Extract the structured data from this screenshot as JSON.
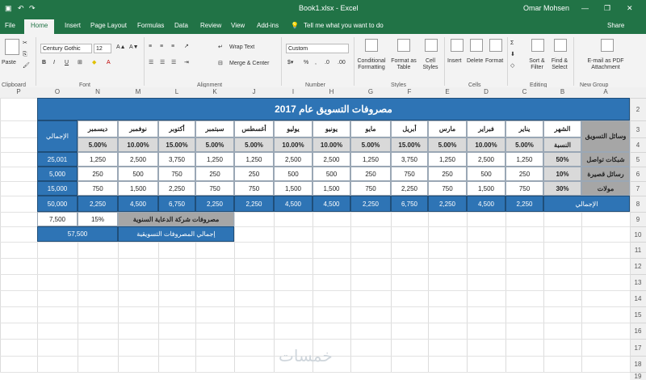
{
  "titlebar": {
    "file_name": "Book1.xlsx - Excel",
    "user": "Omar Mohsen"
  },
  "tabs": [
    "File",
    "Home",
    "Insert",
    "Page Layout",
    "Formulas",
    "Data",
    "Review",
    "View",
    "Add-ins"
  ],
  "tell_me": "Tell me what you want to do",
  "share": "Share",
  "ribbon": {
    "paste": "Paste",
    "font_name": "Century Gothic",
    "font_size": "12",
    "wrap_text": "Wrap Text",
    "merge_center": "Merge & Center",
    "number_format": "Custom",
    "conditional": "Conditional Formatting",
    "format_table": "Format as Table",
    "cell_styles": "Cell Styles",
    "insert": "Insert",
    "delete": "Delete",
    "format": "Format",
    "sort_filter": "Sort & Filter",
    "find_select": "Find & Select",
    "email_pdf": "E-mail as PDF Attachment",
    "groups": [
      "Clipboard",
      "Font",
      "Alignment",
      "Number",
      "Styles",
      "Cells",
      "Editing",
      "New Group"
    ]
  },
  "columns": [
    "P",
    "O",
    "N",
    "M",
    "L",
    "K",
    "J",
    "I",
    "H",
    "G",
    "F",
    "E",
    "D",
    "C",
    "B",
    "A"
  ],
  "rows": [
    "2",
    "3",
    "4",
    "5",
    "6",
    "7",
    "8",
    "9",
    "10",
    "11",
    "12",
    "13",
    "14",
    "15",
    "16",
    "17",
    "18",
    "19"
  ],
  "sheet": {
    "title": "مصروفات التسويق عام 2017",
    "corner_month": "الشهر",
    "corner_channel": "وسائل التسويق",
    "corner_pct": "النسبة",
    "total_label": "الإجمالي",
    "months": [
      "يناير",
      "فبراير",
      "مارس",
      "أبريل",
      "مايو",
      "يونيو",
      "يوليو",
      "أغسطس",
      "سبتمبر",
      "أكتوبر",
      "نوفمبر",
      "ديسمبر"
    ],
    "month_pcts": [
      "5.00%",
      "10.00%",
      "5.00%",
      "15.00%",
      "5.00%",
      "10.00%",
      "10.00%",
      "5.00%",
      "5.00%",
      "15.00%",
      "10.00%",
      "5.00%"
    ],
    "channels": [
      {
        "name": "شبكات تواصل",
        "pct": "50%",
        "values": [
          "1,250",
          "2,500",
          "1,250",
          "3,750",
          "1,250",
          "2,500",
          "2,500",
          "1,250",
          "1,250",
          "3,750",
          "2,500",
          "1,250"
        ],
        "total": "25,001"
      },
      {
        "name": "رسائل قصيرة",
        "pct": "10%",
        "values": [
          "250",
          "500",
          "250",
          "750",
          "250",
          "500",
          "500",
          "250",
          "250",
          "750",
          "500",
          "250"
        ],
        "total": "5,000"
      },
      {
        "name": "مولات",
        "pct": "30%",
        "values": [
          "750",
          "1,500",
          "750",
          "2,250",
          "750",
          "1,500",
          "1,500",
          "750",
          "750",
          "2,250",
          "1,500",
          "750"
        ],
        "total": "15,000"
      }
    ],
    "month_totals": [
      "2,250",
      "4,500",
      "2,250",
      "6,750",
      "2,250",
      "4,500",
      "4,500",
      "2,250",
      "2,250",
      "6,750",
      "4,500",
      "2,250"
    ],
    "grand_total": "50,000",
    "ad_company_label": "مصروفات شركة الدعاية السنوية",
    "ad_company_pct": "15%",
    "ad_company_value": "7,500",
    "total_marketing_label": "إجمالي المصروفات التسويقية",
    "total_marketing_value": "57,500"
  },
  "watermark": "خمسات"
}
